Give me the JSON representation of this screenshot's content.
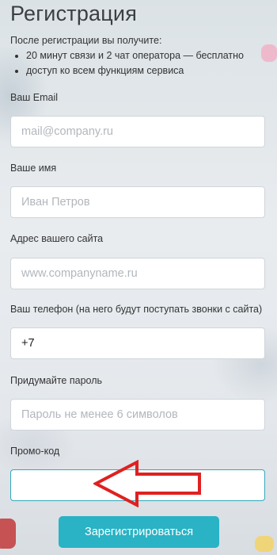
{
  "form": {
    "title": "Регистрация",
    "intro": "После регистрации вы получите:",
    "benefits": [
      "20 минут связи и 2 чат оператора — бесплатно",
      "доступ ко всем функциям сервиса"
    ],
    "fields": {
      "email": {
        "label": "Ваш Email",
        "placeholder": "mail@company.ru",
        "value": ""
      },
      "name": {
        "label": "Ваше имя",
        "placeholder": "Иван Петров",
        "value": ""
      },
      "site": {
        "label": "Адрес вашего сайта",
        "placeholder": "www.companyname.ru",
        "value": ""
      },
      "phone": {
        "label": "Ваш телефон (на него будут поступать звонки с сайта)",
        "placeholder": "",
        "value": "+7"
      },
      "password": {
        "label": "Придумайте пароль",
        "placeholder": "Пароль не менее 6 символов",
        "value": ""
      },
      "promo": {
        "label": "Промо-код",
        "placeholder": "",
        "value": ""
      }
    },
    "submit_label": "Зарегистрироваться"
  },
  "colors": {
    "accent": "#29b3c5",
    "arrow": "#e02020",
    "focus_border": "#35a8bb"
  },
  "icons": {
    "annotation": "red-outline-arrow-left"
  }
}
